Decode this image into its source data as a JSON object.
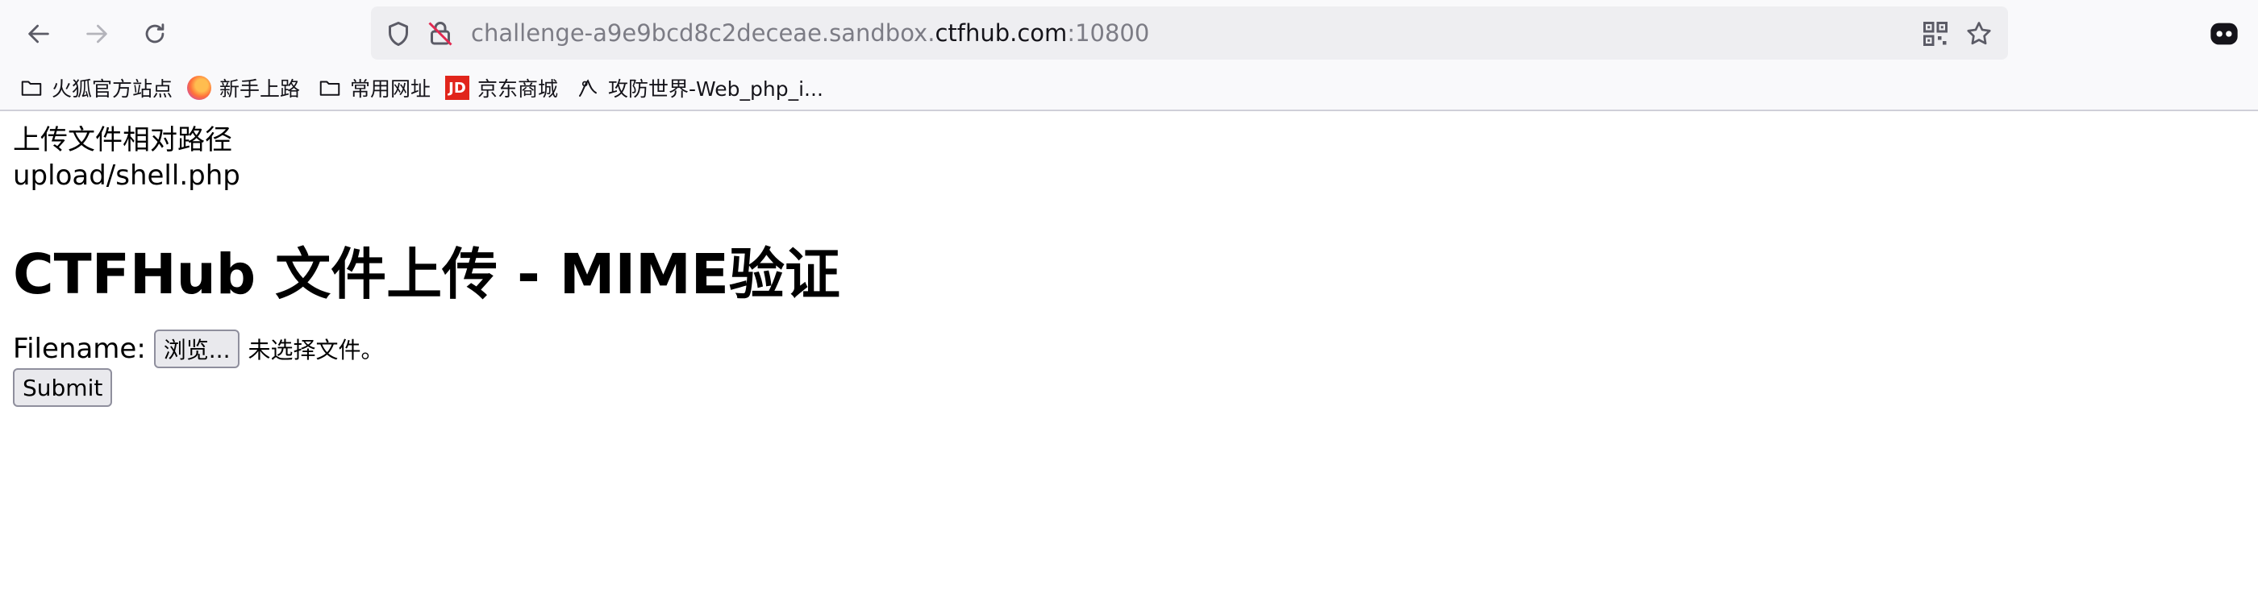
{
  "browser": {
    "url_prefix": "challenge-a9e9bcd8c2deceae.sandbox.",
    "url_host": "ctfhub.com",
    "url_port": ":10800"
  },
  "bookmarks": [
    {
      "label": "火狐官方站点",
      "icon": "folder-icon"
    },
    {
      "label": "新手上路",
      "icon": "firefox-icon"
    },
    {
      "label": "常用网址",
      "icon": "folder-icon"
    },
    {
      "label": "京东商城",
      "icon": "jd-icon",
      "badge": "JD"
    },
    {
      "label": "攻防世界-Web_php_i...",
      "icon": "bookmark-icon"
    }
  ],
  "page": {
    "path_label": "上传文件相对路径",
    "path_value": "upload/shell.php",
    "heading": "CTFHub 文件上传 - MIME验证",
    "filename_label": "Filename:",
    "browse_label": "浏览...",
    "no_file_text": "未选择文件。",
    "submit_label": "Submit"
  }
}
